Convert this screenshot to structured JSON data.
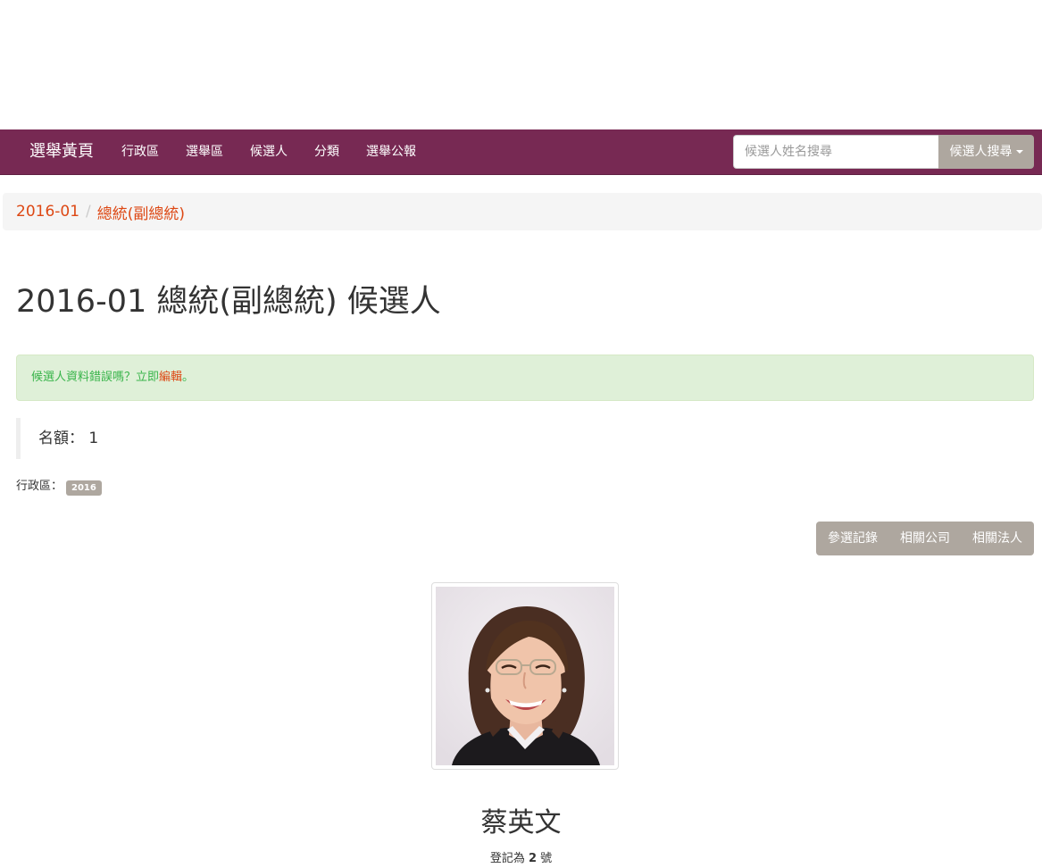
{
  "navbar": {
    "brand": "選舉黃頁",
    "items": [
      "行政區",
      "選舉區",
      "候選人",
      "分類",
      "選舉公報"
    ],
    "search_placeholder": "候選人姓名搜尋",
    "search_button": "候選人搜尋"
  },
  "breadcrumb": {
    "items": [
      "2016-01",
      "總統(副總統)"
    ],
    "separator": "/"
  },
  "page_title": "2016-01 總統(副總統) 候選人",
  "alert": {
    "text_before": "候選人資料錯誤嗎？立即",
    "link": "編輯",
    "text_after": "。"
  },
  "quota": {
    "label": "名額：",
    "value": "1"
  },
  "district": {
    "label": "行政區：",
    "badge": "2016"
  },
  "actions": [
    "參選記錄",
    "相關公司",
    "相關法人"
  ],
  "candidate": {
    "name": "蔡英文",
    "reg_prefix": "登記為",
    "reg_number": "2",
    "reg_suffix": "號"
  },
  "colors": {
    "navbar": "#772953",
    "accent": "#dd4814",
    "neutral": "#aea79f",
    "alert_bg": "#dff0d8",
    "alert_text": "#38b44a"
  }
}
